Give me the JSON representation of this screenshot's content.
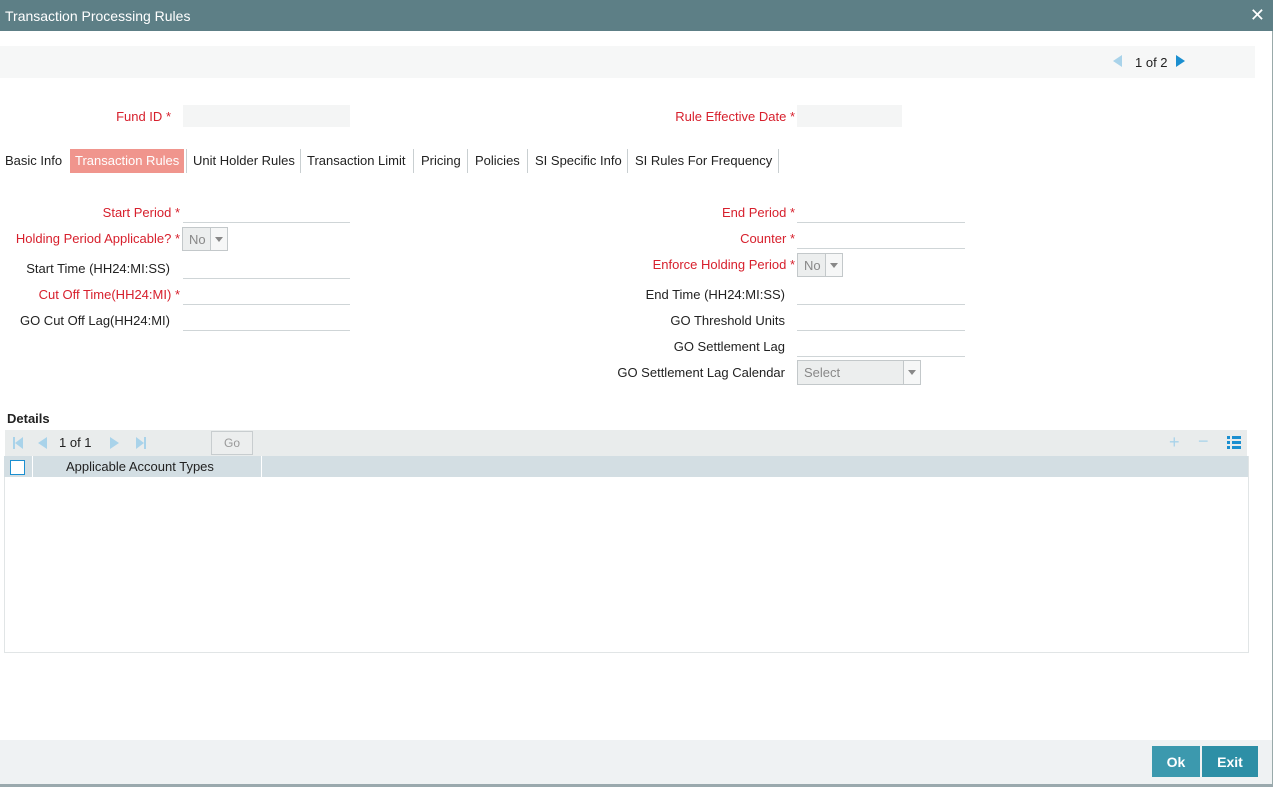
{
  "window": {
    "title": "Transaction Processing Rules",
    "close": "✕"
  },
  "pager": {
    "text": "1 of 2"
  },
  "header": {
    "fund_id": "Fund ID",
    "rule_effective_date": "Rule Effective Date",
    "required_mark": "*"
  },
  "tabs": [
    {
      "label": "Basic Info"
    },
    {
      "label": "Transaction Rules"
    },
    {
      "label": "Unit Holder Rules"
    },
    {
      "label": "Transaction Limit"
    },
    {
      "label": "Pricing"
    },
    {
      "label": "Policies"
    },
    {
      "label": "SI Specific Info"
    },
    {
      "label": "SI Rules For Frequency"
    }
  ],
  "active_tab": "Transaction Rules",
  "form": {
    "start_period": "Start Period",
    "holding_period_applicable": "Holding Period Applicable?",
    "holding_period_value": "No",
    "start_time": "Start Time (HH24:MI:SS)",
    "cut_off_time": "Cut Off Time(HH24:MI)",
    "go_cut_off_lag": "GO Cut Off Lag(HH24:MI)",
    "end_period": "End Period",
    "counter": "Counter",
    "enforce_holding_period": "Enforce Holding Period",
    "enforce_holding_value": "No",
    "end_time": "End Time (HH24:MI:SS)",
    "go_threshold_units": "GO Threshold Units",
    "go_settlement_lag": "GO Settlement Lag",
    "go_settlement_lag_calendar": "GO Settlement Lag Calendar",
    "calendar_value": "Select"
  },
  "details": {
    "title": "Details",
    "pager_text": "1 of 1",
    "go_label": "Go",
    "add": "+",
    "remove": "−",
    "columns": [
      "Applicable Account Types"
    ]
  },
  "footer": {
    "ok": "Ok",
    "exit": "Exit"
  }
}
